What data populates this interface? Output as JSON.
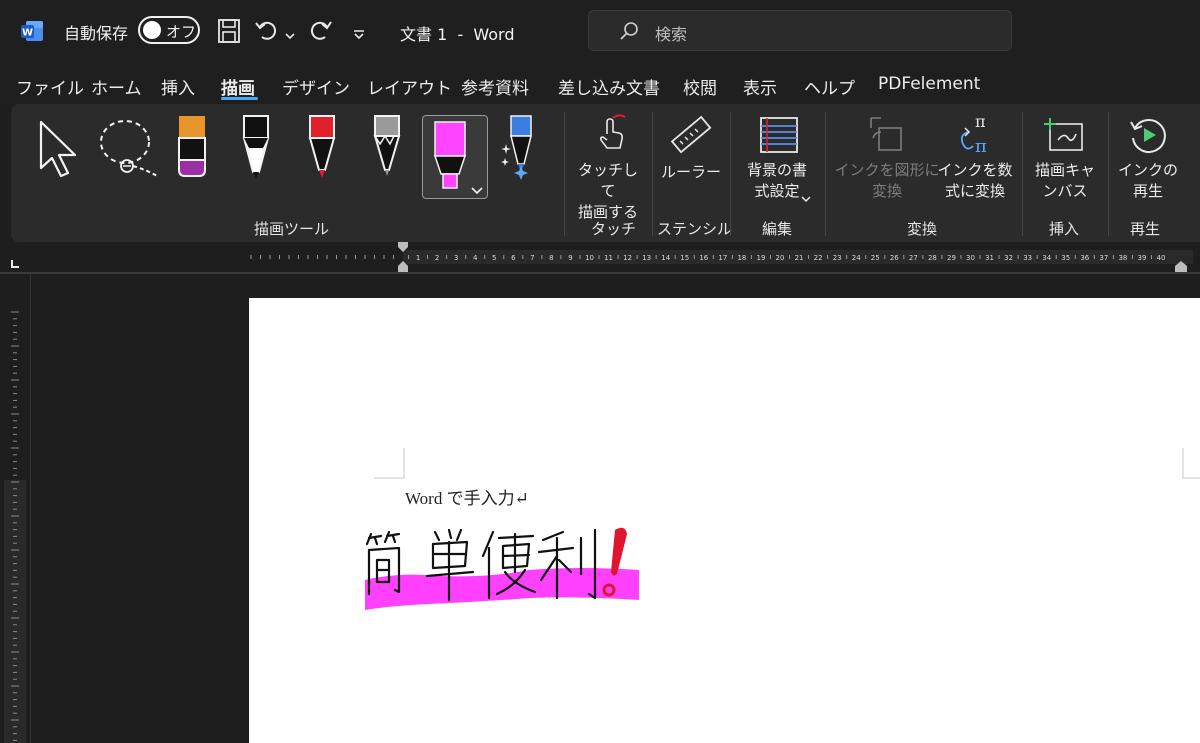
{
  "titlebar": {
    "autosave_label": "自動保存",
    "autosave_state": "オフ",
    "document_title": "文書 1  -  Word",
    "search_placeholder": "検索"
  },
  "tabs": [
    {
      "label": "ファイル"
    },
    {
      "label": "ホーム"
    },
    {
      "label": "挿入"
    },
    {
      "label": "描画",
      "active": true
    },
    {
      "label": "デザイン"
    },
    {
      "label": "レイアウト"
    },
    {
      "label": "参考資料"
    },
    {
      "label": "差し込み文書"
    },
    {
      "label": "校閲"
    },
    {
      "label": "表示"
    },
    {
      "label": "ヘルプ"
    },
    {
      "label": "PDFelement"
    }
  ],
  "ribbon": {
    "groups": {
      "drawing_tools": "描画ツール",
      "touch": "タッチ",
      "stencil": "ステンシル",
      "edit": "編集",
      "convert": "変換",
      "insert": "挿入",
      "replay": "再生"
    },
    "buttons": {
      "draw_with_touch": "タッチして\n描画する",
      "ruler": "ルーラー",
      "background_format": "背景の書\n式設定",
      "ink_to_shape": "インクを図形に\n変換",
      "ink_to_math": "インクを数\n式に変換",
      "drawing_canvas": "描画キャ\nンバス",
      "ink_replay": "インクの\n再生"
    },
    "pen_colors": {
      "orange": "#e8962b",
      "purple": "#9b2fa6",
      "black": "#111111",
      "red": "#e0202a",
      "gray": "#9a9a9a",
      "highlighter": "#ff44ff",
      "blue": "#3b7de0"
    }
  },
  "ruler": {
    "numbers": [
      "1",
      "2",
      "3",
      "4",
      "5",
      "6",
      "7",
      "8",
      "9",
      "10",
      "11",
      "12",
      "13",
      "14",
      "15",
      "16",
      "17",
      "18",
      "19",
      "20",
      "21",
      "22",
      "23",
      "24",
      "25",
      "26",
      "27",
      "28",
      "29",
      "30",
      "31",
      "32",
      "33",
      "34",
      "35",
      "36",
      "37",
      "38",
      "39",
      "40"
    ]
  },
  "document": {
    "typed_text": "Word で手入力↵",
    "handwriting_text": "簡単便利!",
    "highlight_color": "#ff40ff",
    "ink_color": "#111111",
    "exclamation_color": "#e01530"
  }
}
